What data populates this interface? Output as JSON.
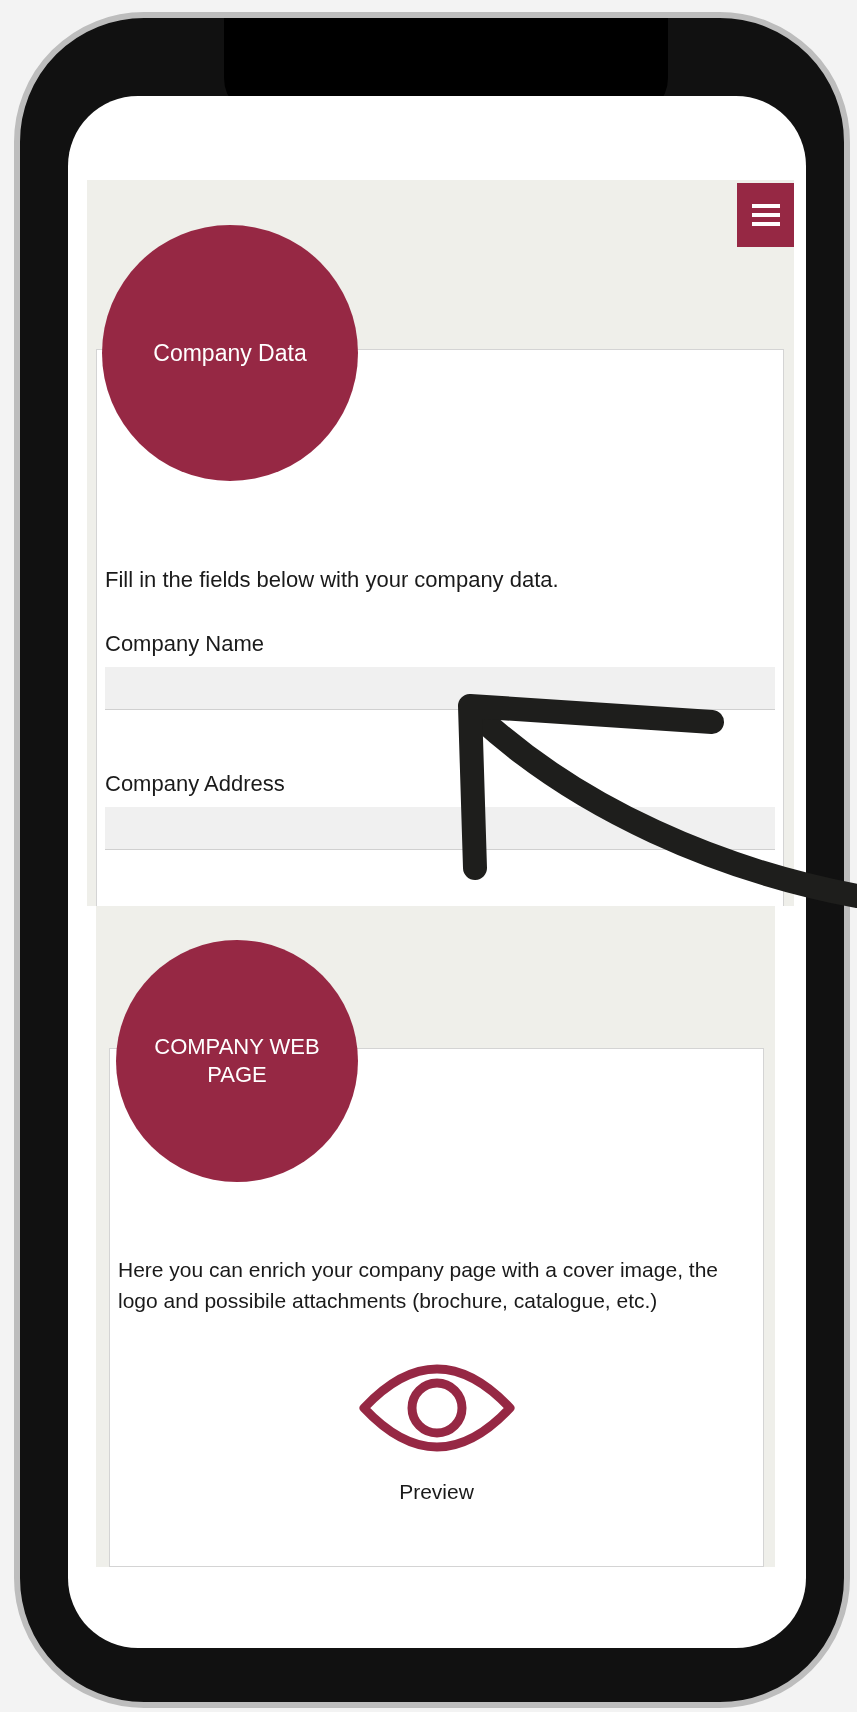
{
  "company_data": {
    "title": "Company Data",
    "intro": "Fill in the fields below with your company data.",
    "fields": [
      {
        "label": "Company Name"
      },
      {
        "label": "Company Address"
      }
    ]
  },
  "company_web_page": {
    "title": "COMPANY WEB PAGE",
    "description": "Here you can enrich your company page with a cover image, the logo and possibile attachments (brochure, catalogue, etc.)",
    "action": {
      "label": "Preview"
    }
  }
}
